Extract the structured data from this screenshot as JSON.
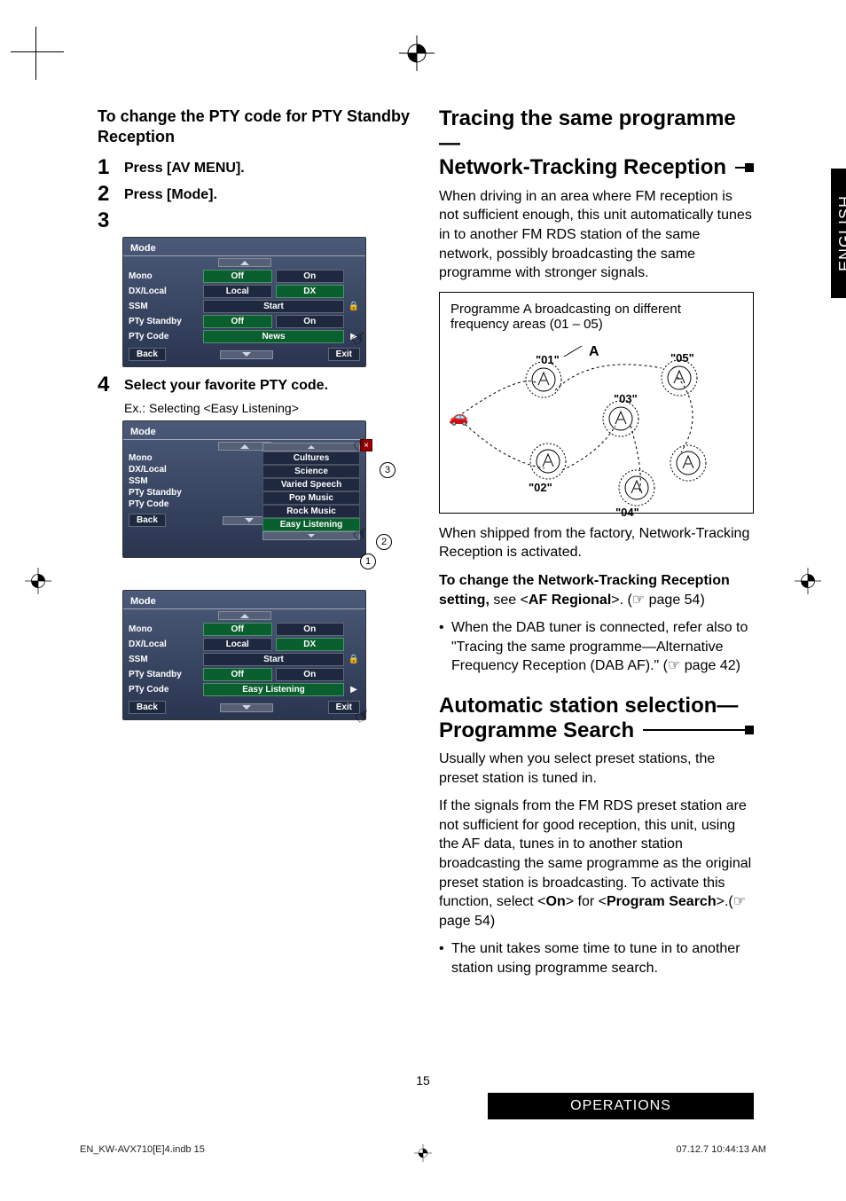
{
  "sideTab": "ENGLISH",
  "left": {
    "heading": "To change the PTY code for PTY Standby Reception",
    "steps": {
      "s1": {
        "num": "1",
        "text": "Press [AV MENU]."
      },
      "s2": {
        "num": "2",
        "text": "Press [Mode]."
      },
      "s3": {
        "num": "3",
        "text": ""
      },
      "s4": {
        "num": "4",
        "text": "Select your favorite PTY code."
      }
    },
    "caption4": "Ex.: Selecting <Easy Listening>",
    "modeBox": {
      "title": "Mode",
      "rows": {
        "mono": "Mono",
        "mono_off": "Off",
        "mono_on": "On",
        "dxlocal": "DX/Local",
        "dx_local": "Local",
        "dx_dx": "DX",
        "ssm": "SSM",
        "ssm_start": "Start",
        "ptystandby": "PTy Standby",
        "pty_off": "Off",
        "pty_on": "On",
        "ptycode": "PTy Code",
        "ptycode_news": "News",
        "ptycode_easy": "Easy Listening"
      },
      "back": "Back",
      "exit": "Exit",
      "list": {
        "i0": "Cultures",
        "i1": "Science",
        "i2": "Varied Speech",
        "i3": "Pop Music",
        "i4": "Rock Music",
        "i5": "Easy Listening"
      }
    },
    "circles": {
      "c1": "1",
      "c2": "2",
      "c3": "3"
    }
  },
  "right": {
    "h1a": "Tracing the same programme—",
    "h1b": "Network-Tracking Reception",
    "p1": "When driving in an area where FM reception is not sufficient enough, this unit automatically tunes in to another FM RDS station of the same network, possibly broadcasting the same programme with stronger signals.",
    "diagCaption": "Programme A broadcasting on different frequency areas (01 – 05)",
    "antA": "A",
    "ant": {
      "a1": "\"01\"",
      "a2": "\"02\"",
      "a3": "\"03\"",
      "a4": "\"04\"",
      "a5": "\"05\""
    },
    "p2": "When shipped from the factory, Network-Tracking Reception is activated.",
    "p3a": "To change the Network-Tracking Reception setting,",
    "p3b": " see <",
    "p3c": "AF Regional",
    "p3d": ">. (☞ page 54)",
    "b1": "When the DAB tuner is connected, refer also to \"Tracing the same programme—Alternative Frequency Reception (DAB AF).\" (☞ page 42)",
    "h2a": "Automatic station selection—",
    "h2b": "Programme Search",
    "p4": "Usually when you select preset stations, the preset station is tuned in.",
    "p5a": "If the signals from the FM RDS preset station are not sufficient for good reception, this unit, using the AF data, tunes in to another station broadcasting the same programme as the original preset station is broadcasting. To activate this function, select <",
    "p5b": "On",
    "p5c": "> for <",
    "p5d": "Program Search",
    "p5e": ">.(☞ page 54)",
    "b2": "The unit takes some time to tune in to another station using programme search."
  },
  "pagenum": "15",
  "opsBar": "OPERATIONS",
  "footer": {
    "left": "EN_KW-AVX710[E]4.indb   15",
    "right": "07.12.7   10:44:13 AM"
  }
}
